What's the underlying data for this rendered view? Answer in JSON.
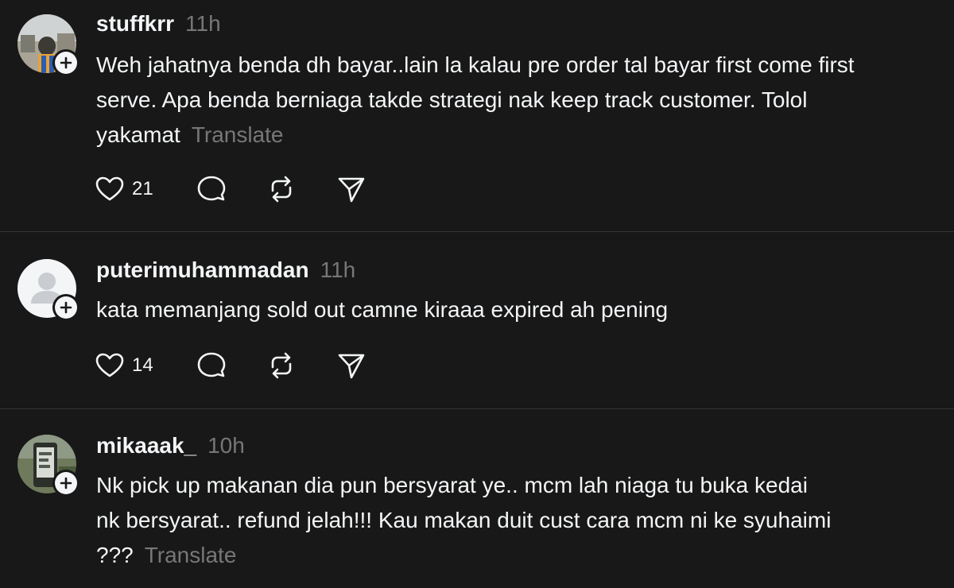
{
  "posts": [
    {
      "username": "stuffkrr",
      "time": "11h",
      "lines": [
        "Weh jahatnya benda dh bayar..lain la kalau pre order tal bayar first come first",
        "serve. Apa benda berniaga takde strategi nak keep track customer. Tolol",
        "yakamat"
      ],
      "translate": "Translate",
      "likes": "21",
      "avatar": "photo-avatar-outdoor"
    },
    {
      "username": "puterimuhammadan",
      "time": "11h",
      "lines": [
        "kata memanjang sold out camne kiraaa expired ah pening"
      ],
      "likes": "14",
      "avatar": "default-avatar"
    },
    {
      "username": "mikaaak_",
      "time": "10h",
      "lines": [
        "Nk pick up makanan dia pun bersyarat ye.. mcm lah niaga tu buka kedai",
        "nk bersyarat.. refund jelah!!! Kau makan duit cust cara mcm ni ke syuhaimi",
        "???"
      ],
      "translate": "Translate",
      "avatar": "photo-avatar-phone"
    }
  ],
  "icons": {
    "like": "heart-icon",
    "reply": "comment-icon",
    "repost": "repost-icon",
    "share": "send-icon",
    "follow": "plus-icon"
  },
  "colors": {
    "background": "#181818",
    "text": "#f3f5f7",
    "muted": "#777777",
    "divider": "#343434"
  }
}
